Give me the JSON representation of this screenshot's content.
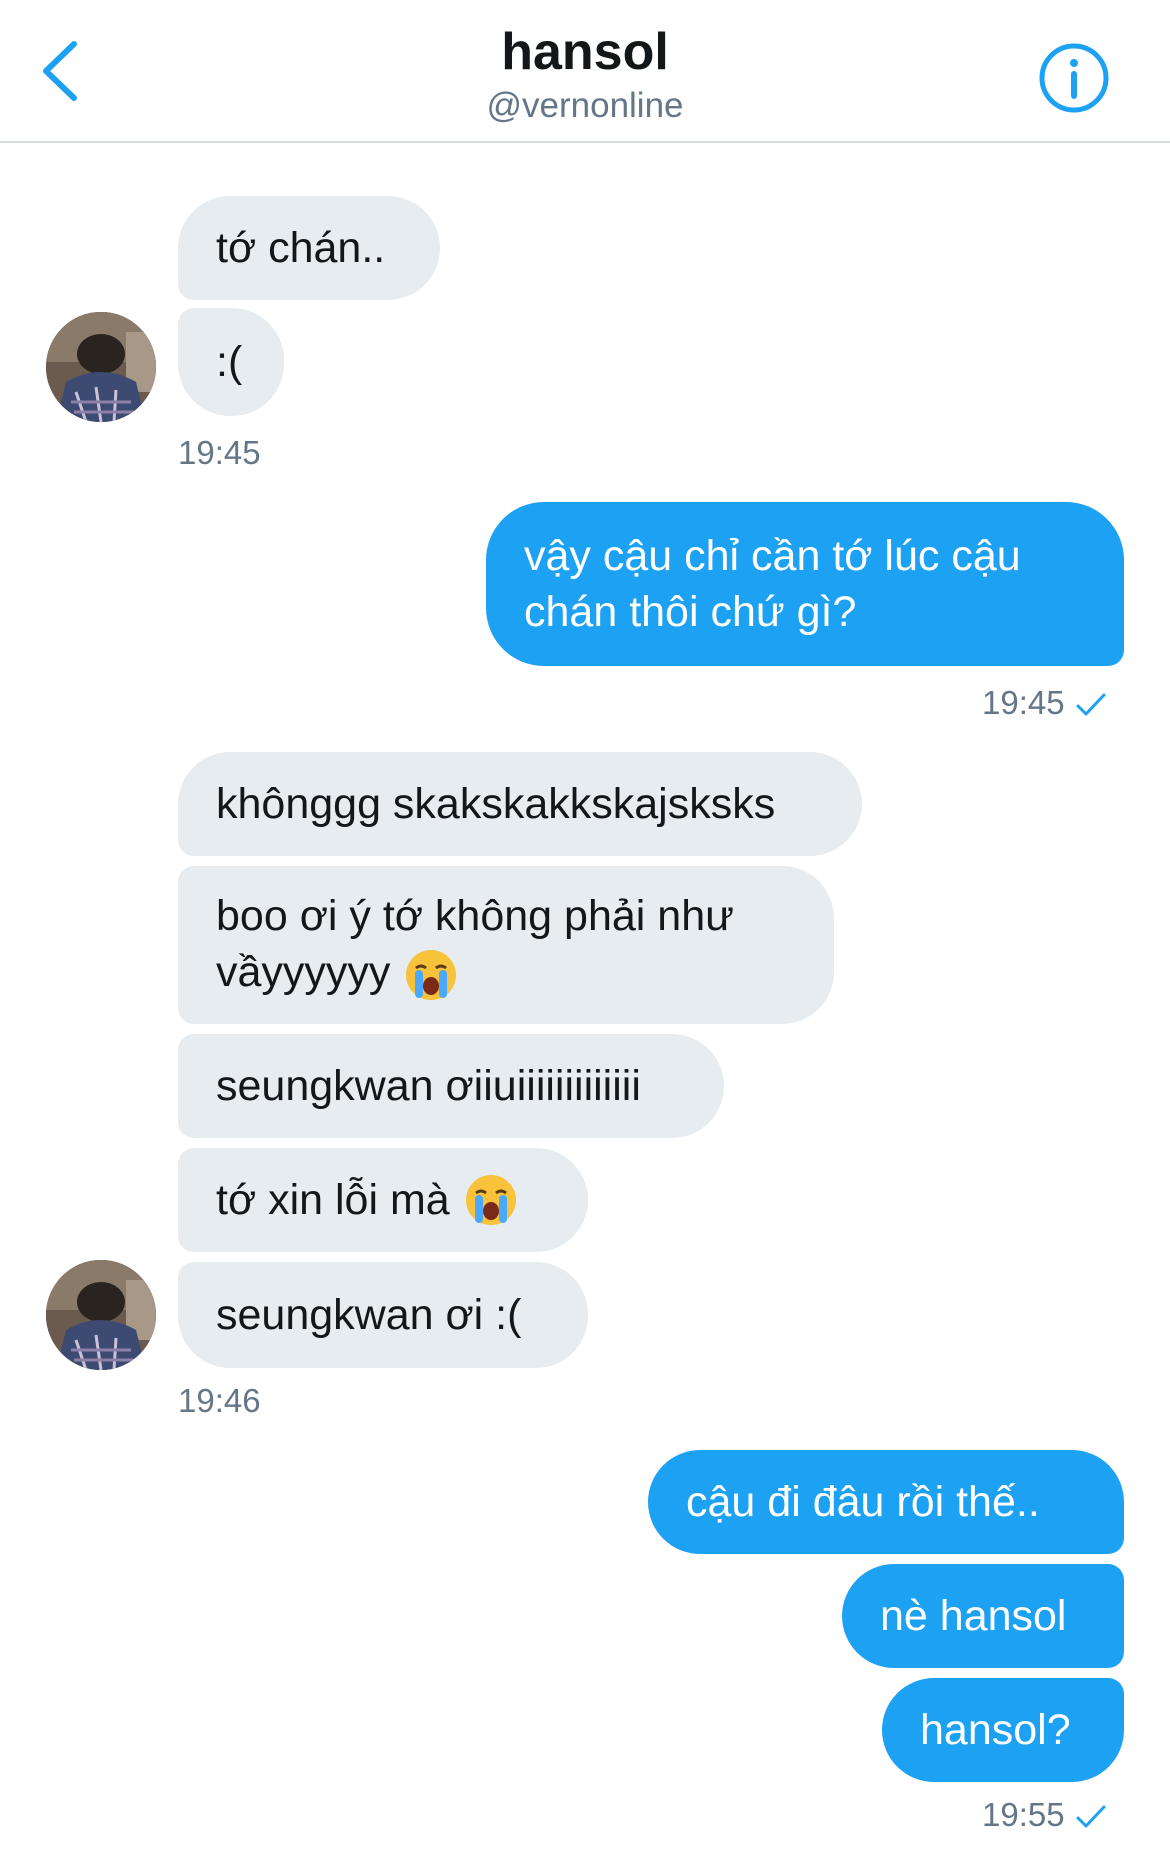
{
  "header": {
    "title": "hansol",
    "handle": "@vernonline",
    "back_icon": "chevron-left-icon",
    "info_icon": "info-icon"
  },
  "colors": {
    "accent": "#1da1f2",
    "incoming_bubble": "#e6ecf0",
    "timestamp": "#657786"
  },
  "messages": [
    {
      "dir": "in",
      "text": "tớ chán.."
    },
    {
      "dir": "in",
      "text": ":("
    },
    {
      "dir": "in",
      "timestamp": "19:45"
    },
    {
      "dir": "out",
      "text": "vậy cậu chỉ cần tớ lúc cậu chán thôi chứ gì?"
    },
    {
      "dir": "out",
      "timestamp": "19:45",
      "status_icon": "checkmark-icon"
    },
    {
      "dir": "in",
      "text": "khônggg skakskakkskajsksks"
    },
    {
      "dir": "in",
      "text": "boo ơi ý tớ không phải như vầyyyyyy",
      "emoji": "loudly-crying-face-icon"
    },
    {
      "dir": "in",
      "text": "seungkwan ơiiuiiiiiiiiiiiii"
    },
    {
      "dir": "in",
      "text": "tớ xin lỗi mà",
      "emoji": "loudly-crying-face-icon"
    },
    {
      "dir": "in",
      "text": "seungkwan ơi :("
    },
    {
      "dir": "in",
      "timestamp": "19:46"
    },
    {
      "dir": "out",
      "text": "cậu đi đâu rồi thế.."
    },
    {
      "dir": "out",
      "text": "nè hansol"
    },
    {
      "dir": "out",
      "text": "hansol?"
    },
    {
      "dir": "out",
      "timestamp": "19:55",
      "status_icon": "checkmark-icon"
    }
  ]
}
